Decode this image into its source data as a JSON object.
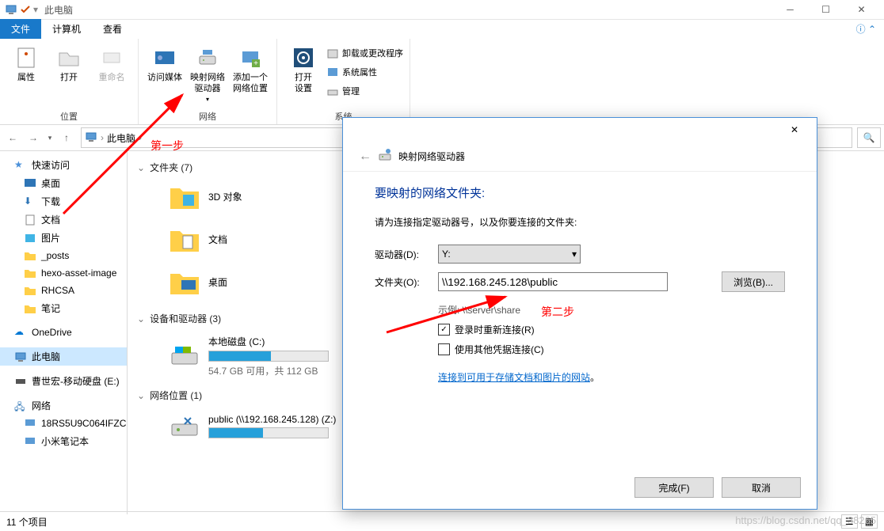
{
  "titlebar": {
    "title": "此电脑"
  },
  "tabs": {
    "file": "文件",
    "computer": "计算机",
    "view": "查看"
  },
  "ribbon": {
    "properties": "属性",
    "open": "打开",
    "rename": "重命名",
    "group1": "位置",
    "access_media": "访问媒体",
    "map_drive": "映射网络\n驱动器",
    "add_location": "添加一个\n网络位置",
    "group2": "网络",
    "open_settings": "打开\n设置",
    "uninstall": "卸载或更改程序",
    "sysprops": "系统属性",
    "manage": "管理",
    "group3": "系统"
  },
  "crumb": {
    "text": "此电脑"
  },
  "sidebar": {
    "quick": "快速访问",
    "desktop": "桌面",
    "downloads": "下载",
    "documents": "文档",
    "pictures": "图片",
    "posts": "_posts",
    "hexo": "hexo-asset-image",
    "rhcsa": "RHCSA",
    "notes": "笔记",
    "onedrive": "OneDrive",
    "thispc": "此电脑",
    "extdrive": "曹世宏-移动硬盘 (E:)",
    "network": "网络",
    "net1": "18RS5U9C064IFZC",
    "net2": "小米笔记本"
  },
  "content": {
    "folders_title": "文件夹 (7)",
    "folders": {
      "3d": "3D 对象",
      "docs": "文档",
      "desktop": "桌面"
    },
    "drives_title": "设备和驱动器 (3)",
    "drive_c": {
      "name": "本地磁盘 (C:)",
      "info": "54.7 GB 可用，共 112 GB"
    },
    "netloc_title": "网络位置 (1)",
    "netloc": {
      "name": "public (\\\\192.168.245.128) (Z:)"
    }
  },
  "dialog": {
    "subtitle": "映射网络驱动器",
    "heading": "要映射的网络文件夹:",
    "desc": "请为连接指定驱动器号，以及你要连接的文件夹:",
    "drive_label": "驱动器(D):",
    "drive_value": "Y:",
    "folder_label": "文件夹(O):",
    "folder_value": "\\\\192.168.245.128\\public",
    "browse": "浏览(B)...",
    "example": "示例: \\\\server\\share",
    "reconnect": "登录时重新连接(R)",
    "other_creds": "使用其他凭据连接(C)",
    "link": "连接到可用于存储文档和图片的网站",
    "period": "。",
    "finish": "完成(F)",
    "cancel": "取消"
  },
  "status": {
    "items": "11 个项目"
  },
  "annotations": {
    "step1": "第一步",
    "step2": "第二步"
  },
  "watermark": "https://blog.csdn.net/qq_38265"
}
